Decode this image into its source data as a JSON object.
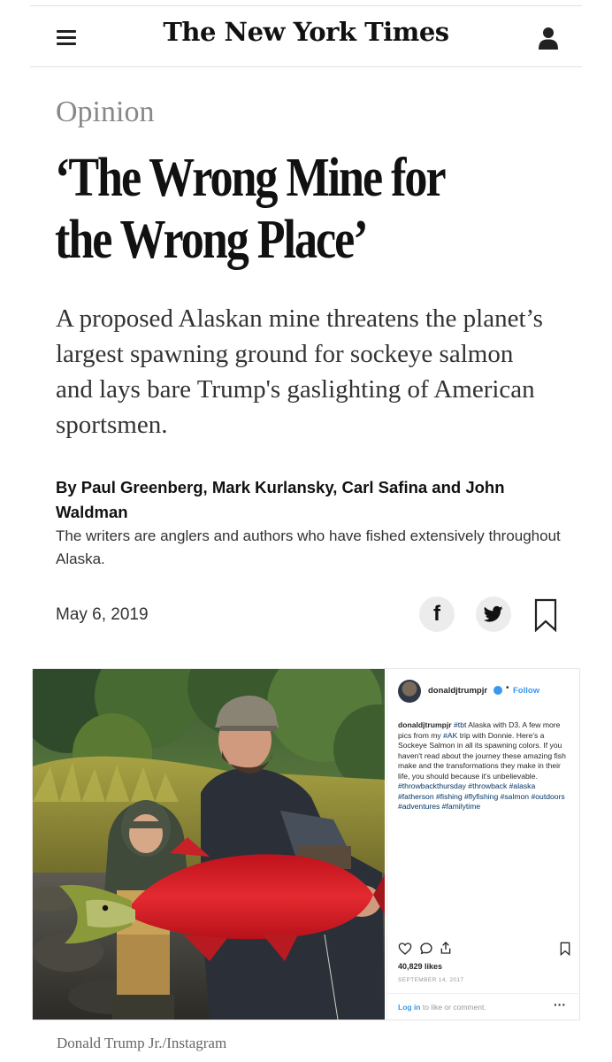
{
  "header": {
    "masthead": "The New York Times",
    "icons": {
      "menu": "hamburger-icon",
      "account": "user-icon"
    }
  },
  "article": {
    "section": "Opinion",
    "headline_line1": "‘The Wrong Mine for",
    "headline_line2": "the Wrong Place’",
    "summary": "A proposed Alaskan mine threatens the planet’s largest spawning ground for sockeye salmon and lays bare Trump's gaslighting of American sportsmen.",
    "byline": "By Paul Greenberg, Mark Kurlansky, Carl Safina and John Waldman",
    "bio": "The writers are anglers and authors who have fished extensively throughout Alaska.",
    "date": "May 6, 2019",
    "share": {
      "facebook_glyph": "f",
      "icons": {
        "facebook": "facebook-icon",
        "twitter": "twitter-icon",
        "save": "bookmark-icon"
      }
    },
    "photo_credit": "Donald Trump Jr./Instagram"
  },
  "instagram": {
    "username": "donaldjtrumpjr",
    "dot": "•",
    "follow": "Follow",
    "caption_user": "donaldjtrumpjr",
    "caption_tag1": "#tbt",
    "caption_text1": " Alaska with D3. A few more pics from my ",
    "caption_tag2": "#AK",
    "caption_text2": " trip with Donnie. Here's a Sockeye Salmon in all its spawning colors. If you haven't read about the journey these amazing fish make and the transformations they make in their life, you should because it's unbelievable. ",
    "caption_hashtags": "#throwbackthursday #throwback #alaska #fatherson #fishing #flyfishing #salmon #outdoors #adventures #familytime",
    "likes": "40,829 likes",
    "date": "SEPTEMBER 14, 2017",
    "login": "Log in",
    "login_suffix": " to like or comment.",
    "more": "···",
    "icons": {
      "like": "heart-icon",
      "comment": "comment-icon",
      "share": "share-icon",
      "save": "bookmark-icon",
      "verified": "verified-badge-icon"
    }
  },
  "colors": {
    "ink": "#121212",
    "kicker": "#888888",
    "insta_blue": "#3897f0",
    "salmon": "#d8232a"
  }
}
